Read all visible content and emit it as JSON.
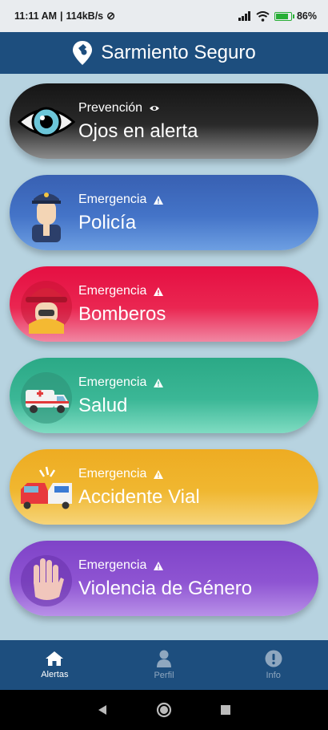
{
  "status_bar": {
    "time": "11:11 AM",
    "speed": "114kB/s",
    "battery": "86%",
    "battery_level": 0.86
  },
  "header": {
    "title": "Sarmiento Seguro",
    "logo_icon": "location-pin-logo"
  },
  "cards": [
    {
      "category": "Prevención",
      "badge_icon": "eye-icon",
      "title": "Ojos en alerta",
      "icon": "eye-icon"
    },
    {
      "category": "Emergencia",
      "badge_icon": "warning-icon",
      "title": "Policía",
      "icon": "police-icon"
    },
    {
      "category": "Emergencia",
      "badge_icon": "warning-icon",
      "title": "Bomberos",
      "icon": "firefighter-icon"
    },
    {
      "category": "Emergencia",
      "badge_icon": "warning-icon",
      "title": "Salud",
      "icon": "ambulance-icon"
    },
    {
      "category": "Emergencia",
      "badge_icon": "warning-icon",
      "title": "Accidente Vial",
      "icon": "car-crash-icon"
    },
    {
      "category": "Emergencia",
      "badge_icon": "warning-icon",
      "title": "Violencia de Género",
      "icon": "stop-hand-icon"
    }
  ],
  "bottom_nav": [
    {
      "label": "Alertas",
      "icon": "home-icon",
      "active": true
    },
    {
      "label": "Perfil",
      "icon": "user-icon",
      "active": false
    },
    {
      "label": "Info",
      "icon": "info-icon",
      "active": false
    }
  ],
  "colors": {
    "header": "#1d4e7e",
    "background": "#b7d3e0",
    "card_prevention": "#2b2b2b",
    "card_police": "#3e6ec0",
    "card_fire": "#e8174a",
    "card_health": "#37b394",
    "card_accident": "#efb62e",
    "card_violence": "#8a4fd0"
  }
}
